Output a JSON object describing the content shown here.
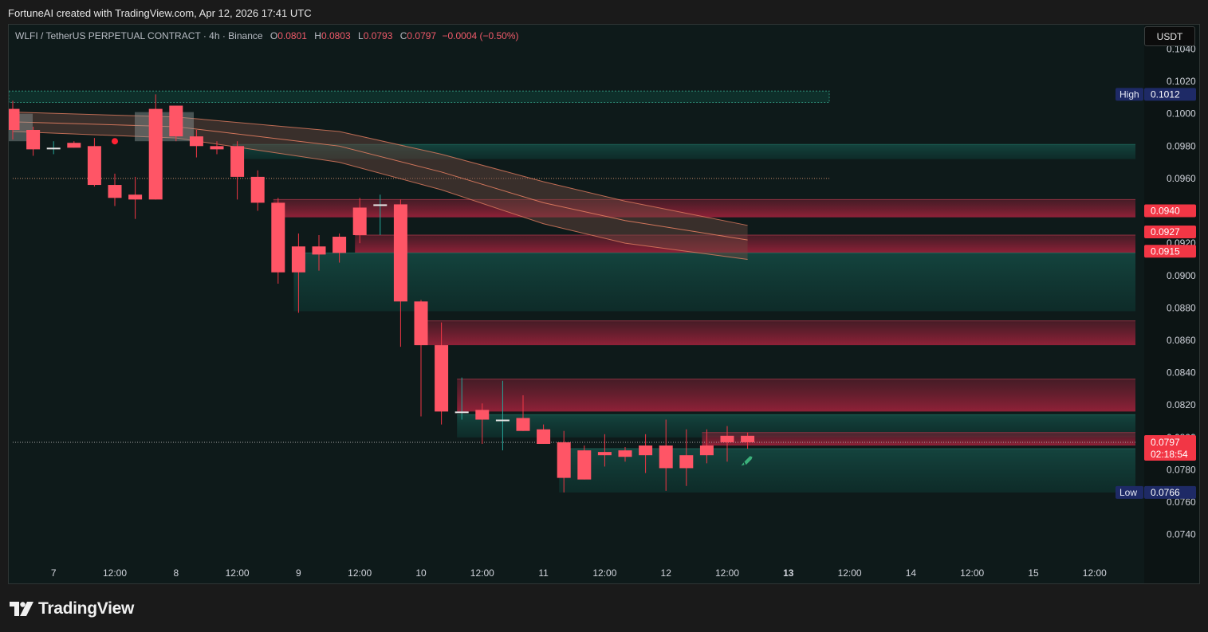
{
  "credit": "FortuneAI created with TradingView.com, Apr 12, 2026 17:41 UTC",
  "legend": {
    "symbol": "WLFI / TetherUS PERPETUAL CONTRACT · 4h · Binance",
    "o_label": "O",
    "o_value": "0.0801",
    "h_label": "H",
    "h_value": "0.0803",
    "l_label": "L",
    "l_value": "0.0793",
    "c_label": "C",
    "c_value": "0.0797",
    "change": "−0.0004 (−0.50%)"
  },
  "currency": "USDT",
  "brand": {
    "name": "TradingView",
    "icon": "tradingview-logo-icon"
  },
  "colors": {
    "background": "#0e1a1a",
    "bear": "#f23645",
    "bear_body": "#ff5566",
    "bull_wick": "#26a69a",
    "axis_text": "#d1d4dc",
    "high_low_tag": "#1e2a66",
    "price_tag": "#f23645",
    "zone_teal": "#0f3b35",
    "zone_red": "#6e1a2a",
    "band": "#e27d60",
    "rocket": "#3bb07a"
  },
  "chart_data": {
    "type": "candlestick",
    "timeframe": "4h",
    "ylim": [
      0.073,
      0.1055
    ],
    "x_ticks": [
      {
        "i": 2,
        "label": "7",
        "bold": false
      },
      {
        "i": 5,
        "label": "12:00",
        "bold": false
      },
      {
        "i": 8,
        "label": "8",
        "bold": false
      },
      {
        "i": 11,
        "label": "12:00",
        "bold": false
      },
      {
        "i": 14,
        "label": "9",
        "bold": false
      },
      {
        "i": 17,
        "label": "12:00",
        "bold": false
      },
      {
        "i": 20,
        "label": "10",
        "bold": false
      },
      {
        "i": 23,
        "label": "12:00",
        "bold": false
      },
      {
        "i": 26,
        "label": "11",
        "bold": false
      },
      {
        "i": 29,
        "label": "12:00",
        "bold": false
      },
      {
        "i": 32,
        "label": "12",
        "bold": false
      },
      {
        "i": 35,
        "label": "12:00",
        "bold": false
      },
      {
        "i": 38,
        "label": "13",
        "bold": true
      },
      {
        "i": 41,
        "label": "12:00",
        "bold": false
      },
      {
        "i": 44,
        "label": "14",
        "bold": false
      },
      {
        "i": 47,
        "label": "12:00",
        "bold": false
      },
      {
        "i": 50,
        "label": "15",
        "bold": false
      },
      {
        "i": 53,
        "label": "12:00",
        "bold": false
      }
    ],
    "y_ticks": [
      "0.1040",
      "0.1020",
      "0.1000",
      "0.0980",
      "0.0960",
      "0.0940",
      "0.0920",
      "0.0900",
      "0.0880",
      "0.0860",
      "0.0840",
      "0.0820",
      "0.0800",
      "0.0780",
      "0.0760",
      "0.0740"
    ],
    "candles": [
      {
        "o": 0.1003,
        "h": 0.1008,
        "l": 0.0984,
        "c": 0.099
      },
      {
        "o": 0.099,
        "h": 0.0992,
        "l": 0.0974,
        "c": 0.0978
      },
      {
        "o": 0.0979,
        "h": 0.0983,
        "l": 0.0975,
        "c": 0.0979
      },
      {
        "o": 0.0982,
        "h": 0.0983,
        "l": 0.0979,
        "c": 0.0979
      },
      {
        "o": 0.098,
        "h": 0.0985,
        "l": 0.0955,
        "c": 0.0956
      },
      {
        "o": 0.0956,
        "h": 0.0963,
        "l": 0.0943,
        "c": 0.0948
      },
      {
        "o": 0.095,
        "h": 0.0961,
        "l": 0.0935,
        "c": 0.0947
      },
      {
        "o": 0.1003,
        "h": 0.1012,
        "l": 0.0947,
        "c": 0.0947
      },
      {
        "o": 0.1005,
        "h": 0.1005,
        "l": 0.0983,
        "c": 0.0986
      },
      {
        "o": 0.0986,
        "h": 0.099,
        "l": 0.0973,
        "c": 0.098
      },
      {
        "o": 0.098,
        "h": 0.0983,
        "l": 0.0975,
        "c": 0.0978
      },
      {
        "o": 0.098,
        "h": 0.0983,
        "l": 0.0947,
        "c": 0.0961
      },
      {
        "o": 0.0961,
        "h": 0.0965,
        "l": 0.094,
        "c": 0.0945
      },
      {
        "o": 0.0945,
        "h": 0.0948,
        "l": 0.0895,
        "c": 0.0902
      },
      {
        "o": 0.0918,
        "h": 0.0926,
        "l": 0.0877,
        "c": 0.0902
      },
      {
        "o": 0.0918,
        "h": 0.0925,
        "l": 0.0903,
        "c": 0.0913
      },
      {
        "o": 0.0924,
        "h": 0.0926,
        "l": 0.0908,
        "c": 0.0914
      },
      {
        "o": 0.0942,
        "h": 0.0948,
        "l": 0.092,
        "c": 0.0925
      },
      {
        "o": 0.0944,
        "h": 0.095,
        "l": 0.0925,
        "c": 0.0944
      },
      {
        "o": 0.0944,
        "h": 0.0947,
        "l": 0.0856,
        "c": 0.0884
      },
      {
        "o": 0.0884,
        "h": 0.0885,
        "l": 0.0813,
        "c": 0.0857
      },
      {
        "o": 0.0857,
        "h": 0.0871,
        "l": 0.0808,
        "c": 0.0816
      },
      {
        "o": 0.0816,
        "h": 0.0837,
        "l": 0.0811,
        "c": 0.0816
      },
      {
        "o": 0.0817,
        "h": 0.0821,
        "l": 0.0796,
        "c": 0.0811
      },
      {
        "o": 0.0811,
        "h": 0.0835,
        "l": 0.0792,
        "c": 0.0811
      },
      {
        "o": 0.0812,
        "h": 0.0826,
        "l": 0.0804,
        "c": 0.0804
      },
      {
        "o": 0.0805,
        "h": 0.0808,
        "l": 0.0796,
        "c": 0.0796
      },
      {
        "o": 0.0797,
        "h": 0.0804,
        "l": 0.0766,
        "c": 0.0775
      },
      {
        "o": 0.0792,
        "h": 0.0795,
        "l": 0.0774,
        "c": 0.0774
      },
      {
        "o": 0.0791,
        "h": 0.0802,
        "l": 0.0782,
        "c": 0.0789
      },
      {
        "o": 0.0792,
        "h": 0.0794,
        "l": 0.0785,
        "c": 0.0788
      },
      {
        "o": 0.0795,
        "h": 0.0802,
        "l": 0.0778,
        "c": 0.0789
      },
      {
        "o": 0.0795,
        "h": 0.0811,
        "l": 0.0767,
        "c": 0.0781
      },
      {
        "o": 0.0789,
        "h": 0.0805,
        "l": 0.077,
        "c": 0.0781
      },
      {
        "o": 0.0795,
        "h": 0.0805,
        "l": 0.0784,
        "c": 0.0789
      },
      {
        "o": 0.0801,
        "h": 0.0807,
        "l": 0.0785,
        "c": 0.0797
      },
      {
        "o": 0.0801,
        "h": 0.0803,
        "l": 0.0793,
        "c": 0.0797
      }
    ],
    "band_upper": [
      {
        "i": 0,
        "v": 0.1001
      },
      {
        "i": 8,
        "v": 0.0998
      },
      {
        "i": 16,
        "v": 0.0989
      },
      {
        "i": 21,
        "v": 0.0975
      },
      {
        "i": 26,
        "v": 0.0958
      },
      {
        "i": 30,
        "v": 0.0946
      },
      {
        "i": 36,
        "v": 0.0931
      }
    ],
    "band_mid": [
      {
        "i": 0,
        "v": 0.0995
      },
      {
        "i": 8,
        "v": 0.0992
      },
      {
        "i": 16,
        "v": 0.098
      },
      {
        "i": 21,
        "v": 0.0964
      },
      {
        "i": 26,
        "v": 0.0945
      },
      {
        "i": 30,
        "v": 0.0934
      },
      {
        "i": 36,
        "v": 0.0922
      }
    ],
    "band_lower": [
      {
        "i": 0,
        "v": 0.0989
      },
      {
        "i": 8,
        "v": 0.0985
      },
      {
        "i": 16,
        "v": 0.097
      },
      {
        "i": 21,
        "v": 0.0953
      },
      {
        "i": 26,
        "v": 0.0932
      },
      {
        "i": 30,
        "v": 0.092
      },
      {
        "i": 36,
        "v": 0.091
      }
    ],
    "zones": [
      {
        "top": 0.1014,
        "bottom": 0.1007,
        "from": 0,
        "to": 40,
        "kind": "outline"
      },
      {
        "top": 0.0981,
        "bottom": 0.0972,
        "from": 11,
        "to": 55,
        "kind": "teal"
      },
      {
        "top": 0.0947,
        "bottom": 0.0936,
        "from": 13,
        "to": 55,
        "kind": "red"
      },
      {
        "top": 0.0925,
        "bottom": 0.0914,
        "from": 17,
        "to": 55,
        "kind": "red"
      },
      {
        "top": 0.0914,
        "bottom": 0.0878,
        "from": 14,
        "to": 55,
        "kind": "teal"
      },
      {
        "top": 0.0872,
        "bottom": 0.0857,
        "from": 20,
        "to": 55,
        "kind": "red"
      },
      {
        "top": 0.0836,
        "bottom": 0.0816,
        "from": 22,
        "to": 55,
        "kind": "red"
      },
      {
        "top": 0.0814,
        "bottom": 0.08,
        "from": 22,
        "to": 55,
        "kind": "teal"
      },
      {
        "top": 0.0803,
        "bottom": 0.0795,
        "from": 34,
        "to": 55,
        "kind": "red"
      },
      {
        "top": 0.0793,
        "bottom": 0.0766,
        "from": 27,
        "to": 55,
        "kind": "teal"
      }
    ],
    "dotted_lines": [
      {
        "v": 0.096,
        "from": 0,
        "to": 40,
        "color": "#c98a6a"
      },
      {
        "v": 0.0797,
        "from": 0,
        "to": 55,
        "color": "#a8a8a8"
      }
    ],
    "price_tags": [
      {
        "value": "0.0940",
        "v": 0.094,
        "style": "red"
      },
      {
        "value": "0.0927",
        "v": 0.0927,
        "style": "red"
      },
      {
        "value": "0.0915",
        "v": 0.0915,
        "style": "red"
      }
    ],
    "high": {
      "label": "High",
      "value": "0.1012",
      "v": 0.1012
    },
    "low": {
      "label": "Low",
      "value": "0.0766",
      "v": 0.0766
    },
    "last_price": {
      "value": "0.0797",
      "countdown": "02:18:54",
      "v": 0.0797
    },
    "signal_dot": {
      "i": 5,
      "v": 0.0983
    }
  }
}
